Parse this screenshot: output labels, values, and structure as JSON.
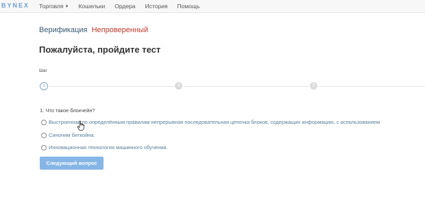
{
  "header": {
    "logo": "BYNEX",
    "nav": [
      {
        "label": "Торговля",
        "has_dropdown": true
      },
      {
        "label": "Кошельки"
      },
      {
        "label": "Ордера"
      },
      {
        "label": "История"
      },
      {
        "label": "Помощь"
      }
    ]
  },
  "verification": {
    "label": "Верификация",
    "status": "Непроверенный",
    "status_color": "#c0392b"
  },
  "page_title": "Пожалуйста, пройдите тест",
  "stepper": {
    "label": "Шаг",
    "steps": [
      "1",
      "2",
      "3"
    ],
    "current_step": 1
  },
  "quiz": {
    "question": "1. Что такое блокчейн?",
    "options": [
      "Выстроенная по определённым правилам непрерывная последовательная цепочка блоков, содержащих информацию, с использованием",
      "Синоним биткойна.",
      "Инновационная технология машинного обучения."
    ],
    "selected_option": null
  },
  "actions": {
    "next_label": "Следующий вопрос"
  },
  "colors": {
    "accent": "#86b6e6",
    "link_text": "#5a7d99",
    "verification_label": "#3a5a78"
  }
}
